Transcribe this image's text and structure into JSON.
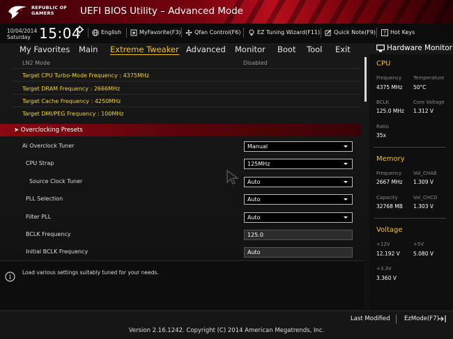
{
  "header": {
    "brand_line1": "REPUBLIC OF",
    "brand_line2": "GAMERS",
    "title": "UEFI BIOS Utility – Advanced Mode"
  },
  "infobar": {
    "date": "10/04/2014",
    "day": "Saturday",
    "time": "15:04",
    "language": "English",
    "my_favorite": "MyFavorite(F3)",
    "qfan": "Qfan Control(F6)",
    "ez_tuning": "EZ Tuning Wizard(F11)",
    "quick_note": "Quick Note(F9)",
    "hot_keys": "Hot Keys"
  },
  "nav": {
    "tabs": [
      {
        "label": "My Favorites"
      },
      {
        "label": "Main"
      },
      {
        "label": "Extreme Tweaker",
        "active": true
      },
      {
        "label": "Advanced"
      },
      {
        "label": "Monitor"
      },
      {
        "label": "Boot"
      },
      {
        "label": "Tool"
      },
      {
        "label": "Exit"
      }
    ]
  },
  "main": {
    "ln2_label": "LN2 Mode",
    "ln2_value": "Disabled",
    "targets": [
      "Target CPU Turbo-Mode Frequency : 4375MHz",
      "Target DRAM Frequency : 2666MHz",
      "Target Cache Frequency : 4250MHz",
      "Target DMI/PEG Frequency : 100MHz"
    ],
    "presets_label": "Overclocking Presets",
    "settings": [
      {
        "label": "Ai Overclock Tuner",
        "value": "Manual"
      },
      {
        "label": "CPU Strap",
        "value": "125MHz"
      },
      {
        "label": "Source Clock Tuner",
        "value": "Auto"
      },
      {
        "label": "PLL Selection",
        "value": "Auto"
      },
      {
        "label": "Filter PLL",
        "value": "Auto"
      },
      {
        "label": "BCLK Frequency",
        "value": "125.0"
      },
      {
        "label": "Initial BCLK Frequency",
        "value": "Auto"
      }
    ]
  },
  "help": {
    "text": "Load various settings suitably tuned for your needs."
  },
  "hw": {
    "title": "Hardware Monitor",
    "cpu": {
      "heading": "CPU",
      "freq_label": "Frequency",
      "freq_value": "4375 MHz",
      "temp_label": "Temperature",
      "temp_value": "50°C",
      "bclk_label": "BCLK",
      "bclk_value": "125.0 MHz",
      "vcore_label": "Core Voltage",
      "vcore_value": "1.312 V",
      "ratio_label": "Ratio",
      "ratio_value": "35x"
    },
    "memory": {
      "heading": "Memory",
      "freq_label": "Frequency",
      "freq_value": "2667 MHz",
      "chab_label": "Vol_CHAB",
      "chab_value": "1.309 V",
      "cap_label": "Capacity",
      "cap_value": "32768 MB",
      "chcd_label": "Vol_CHCD",
      "chcd_value": "1.303 V"
    },
    "voltage": {
      "heading": "Voltage",
      "v12_label": "+12V",
      "v12_value": "12.192 V",
      "v5_label": "+5V",
      "v5_value": "5.080 V",
      "v33_label": "+3.3V",
      "v33_value": "3.360 V"
    }
  },
  "footer": {
    "last_modified": "Last Modified",
    "ezmode": "EzMode(F7)",
    "version": "Version 2.16.1242. Copyright (C) 2014 American Megatrends, Inc."
  },
  "colors": {
    "accent": "#f2c418",
    "brand_red": "#b80e1c"
  }
}
